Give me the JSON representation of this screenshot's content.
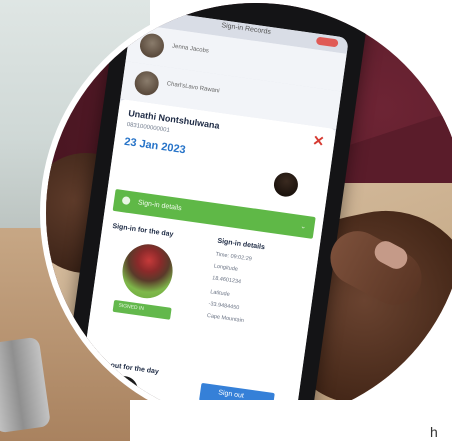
{
  "status_bar": {
    "title": "Sign-in Records"
  },
  "list": [
    {
      "name": "Jenna Jacobs"
    },
    {
      "name": "Charl'sLavo Rawani"
    }
  ],
  "modal": {
    "name": "Unathi Nontshulwana",
    "id": "0831000000001",
    "date": "23 Jan 2023",
    "close": "✕",
    "green_bar": {
      "label": "Sign-in details",
      "chevron": "⌄"
    },
    "sign_in_title": "Sign-in for the day",
    "details_title": "Sign-in details",
    "details": [
      "Time: 09:02:29",
      "Longitude",
      "18.4601234",
      "Latitude",
      "-33.9484450",
      "Cape Mountain"
    ],
    "sign_in_badge": "SIGNED IN",
    "sign_out_title": "Sign-out for the day",
    "sign_out_button": "Sign out"
  },
  "corner_char": "h"
}
